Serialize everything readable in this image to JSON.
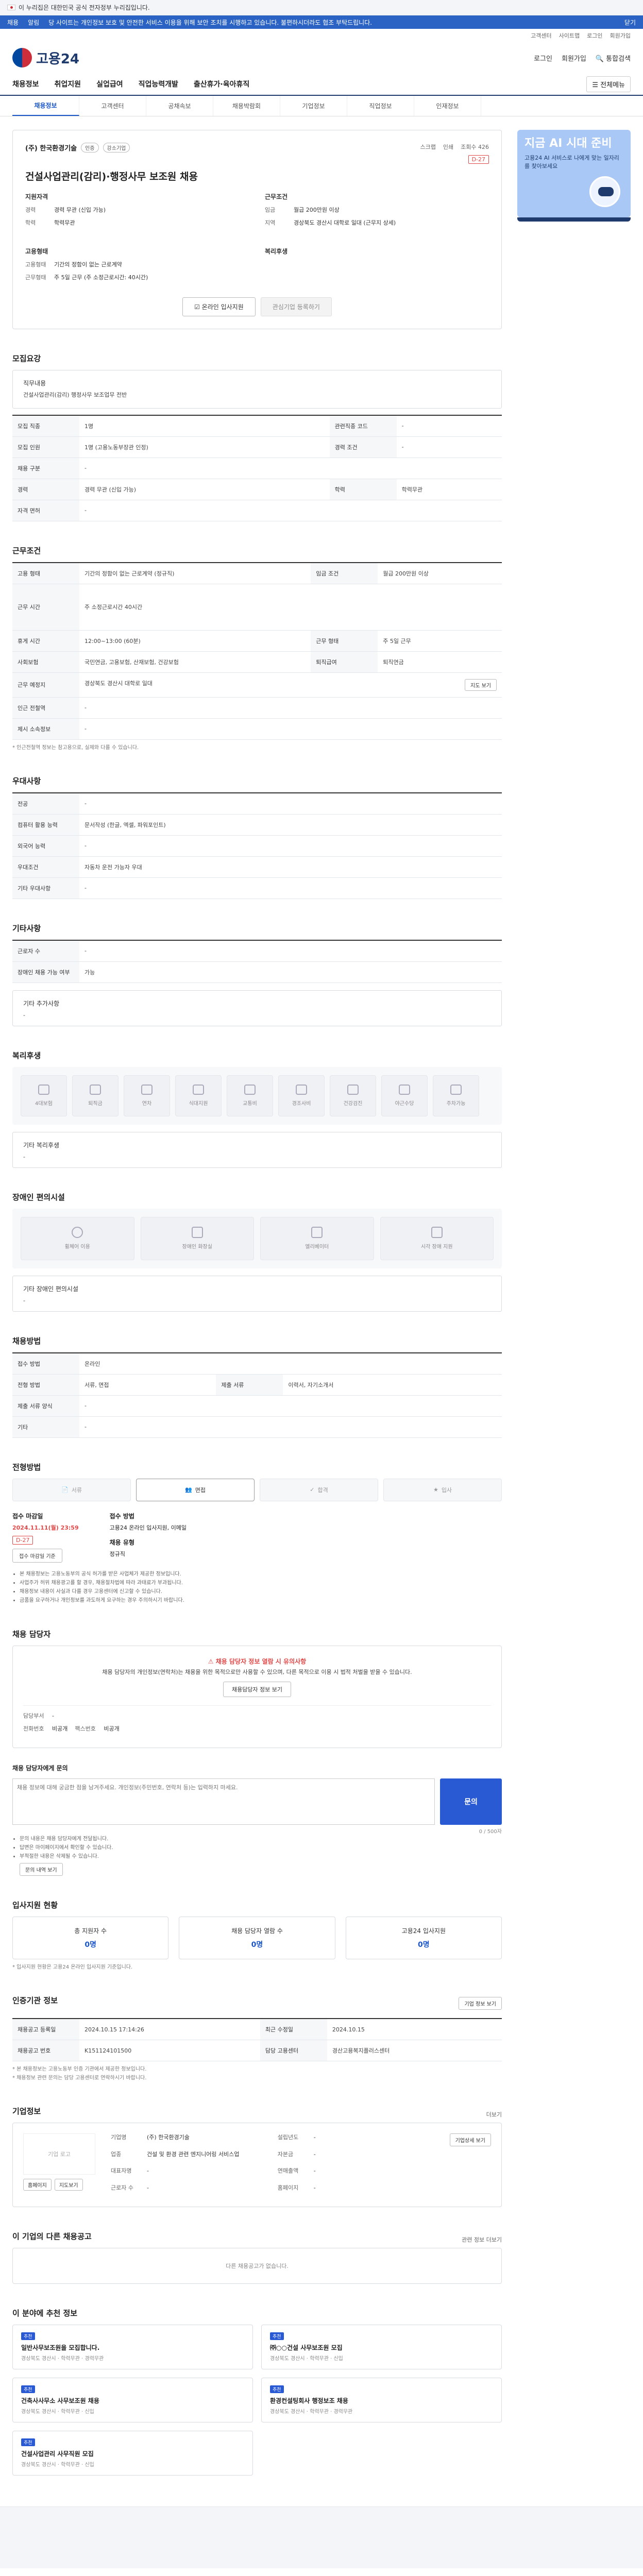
{
  "gov_bar": {
    "text": "이 누리집은 대한민국 공식 전자정부 누리집입니다."
  },
  "notice": {
    "left_items": [
      "채용",
      "알림"
    ],
    "marquee": "당 사이트는 개인정보 보호 및 안전한 서비스 이용을 위해 보안 조치를 시행하고 있습니다. 불편하시더라도 협조 부탁드립니다.",
    "right_items": [
      "닫기"
    ]
  },
  "util": {
    "items": [
      "고객센터",
      "사이트맵",
      "로그인",
      "회원가입"
    ]
  },
  "header": {
    "logo_text": "고용24",
    "right": [
      "로그인",
      "회원가입",
      "통합검색"
    ]
  },
  "gnb": {
    "items": [
      "채용정보",
      "취업지원",
      "실업급여",
      "직업능력개발",
      "출산휴가·육아휴직"
    ],
    "all_menu": "전체메뉴"
  },
  "subtabs": [
    "채용정보",
    "고객센터",
    "공채속보",
    "채용박람회",
    "기업정보",
    "직업정보",
    "인재정보"
  ],
  "banner": {
    "title": "지금 AI 시대 준비",
    "sub": "고용24 AI 서비스로 나에게 맞는 일자리를 찾아보세요"
  },
  "job": {
    "company": "(주) 한국환경기술",
    "badges": [
      "인증",
      "강소기업"
    ],
    "title": "건설사업관리(감리)·행정사무 보조원 채용",
    "actions": [
      "스크랩",
      "인쇄",
      "조회수 426"
    ],
    "dday": "D-27",
    "sec1_title": "지원자격",
    "sec1": [
      {
        "k": "경력",
        "v": "경력 무관 (신입 가능)"
      },
      {
        "k": "학력",
        "v": "학력무관"
      }
    ],
    "sec2_title": "근무조건",
    "sec2": [
      {
        "k": "임금",
        "v": "월급 200만원 이상"
      },
      {
        "k": "지역",
        "v": "경상북도 경산시 대학로 일대 (근무지 상세)"
      }
    ],
    "sec3_title": "고용형태",
    "sec3": [
      {
        "k": "고용형태",
        "v": "기간의 정함이 없는 근로계약"
      },
      {
        "k": "근무형태",
        "v": "주 5일 근무 (주 소정근로시간: 40시간)"
      }
    ],
    "sec4_title": "복리후생",
    "btn_apply": "온라인 입사지원",
    "btn_interest": "관심기업 등록하기"
  },
  "recruit": {
    "title": "모집요강",
    "duty_label": "직무내용",
    "duty": "건설사업관리(감리) 행정사무 보조업무 전반",
    "rows": [
      {
        "k1": "모집 직종",
        "v1": "1명",
        "k2": "관련직종 코드",
        "v2": "-"
      },
      {
        "k1": "모집 인원",
        "v1": "1명 (고용노동부장관 인정)",
        "k2": "경력 조건",
        "v2": "-"
      },
      {
        "k1": "채용 구분",
        "v1": "-",
        "k2": "",
        "v2": ""
      },
      {
        "k1": "경력",
        "v1": "경력 무관 (신입 가능)",
        "k2": "학력",
        "v2": "학력무관"
      },
      {
        "k1": "자격 면허",
        "v1": "-",
        "k2": "",
        "v2": ""
      }
    ]
  },
  "condition": {
    "title": "근무조건",
    "rows": [
      {
        "k1": "고용 형태",
        "v1": "기간의 정함이 없는 근로계약 (정규직)",
        "k2": "임금 조건",
        "v2": "월급 200만원 이상"
      },
      {
        "k1": "근무 시간",
        "v1": "주 소정근로시간 40시간",
        "k2": "",
        "v2": ""
      },
      {
        "k1": "휴게 시간",
        "v1": "12:00~13:00 (60분)",
        "k2": "근무 형태",
        "v2": "주 5일 근무"
      },
      {
        "k1": "사회보험",
        "v1": "국민연금, 고용보험, 산재보험, 건강보험",
        "k2": "퇴직급여",
        "v2": "퇴직연금"
      },
      {
        "k1": "근무 예정지",
        "v1": "경상북도 경산시 대학로 일대",
        "k2": "",
        "v2": ""
      },
      {
        "k1": "인근 전철역",
        "v1": "-",
        "k2": "",
        "v2": ""
      },
      {
        "k1": "제시 소속정보",
        "v1": "-",
        "k2": "",
        "v2": ""
      }
    ],
    "map_button": "지도 보기",
    "note": "* 인근전철역 정보는 참고용으로, 실제와 다를 수 있습니다."
  },
  "preference": {
    "title": "우대사항",
    "rows": [
      {
        "k": "전공",
        "v": "-"
      },
      {
        "k": "컴퓨터 활용 능력",
        "v": "문서작성 (한글, 엑셀, 파워포인트)"
      },
      {
        "k": "외국어 능력",
        "v": "-"
      },
      {
        "k": "우대조건",
        "v": "자동차 운전 가능자 우대"
      },
      {
        "k": "기타 우대사항",
        "v": "-"
      }
    ]
  },
  "etc": {
    "title": "기타사항",
    "rows": [
      {
        "k": "근로자 수",
        "v": "-"
      },
      {
        "k": "장애인 채용 가능 여부",
        "v": "가능"
      }
    ],
    "extra_label": "기타 추가사항",
    "extra_value": "-"
  },
  "welfare": {
    "title": "복리후생",
    "icons": [
      "4대보험",
      "퇴직금",
      "연차",
      "식대지원",
      "교통비",
      "경조사비",
      "건강검진",
      "야근수당",
      "주차가능"
    ],
    "extra_label": "기타 복리후생",
    "extra_value": "-"
  },
  "disabled": {
    "title": "장애인 편의시설",
    "cards": [
      "휠체어 이용",
      "장애인 화장실",
      "엘리베이터",
      "시각 장애 지원"
    ],
    "extra_label": "기타 장애인 편의시설",
    "extra_value": "-"
  },
  "selection": {
    "title": "채용방법",
    "rows": [
      {
        "k1": "접수 방법",
        "v1": "온라인",
        "k2": "",
        "v2": ""
      },
      {
        "k1": "전형 방법",
        "v1": "서류, 면접",
        "k2": "제출 서류",
        "v2": "이력서, 자기소개서"
      },
      {
        "k1": "제출 서류 양식",
        "v1": "-",
        "k2": "",
        "v2": ""
      },
      {
        "k1": "기타",
        "v1": "-",
        "k2": "",
        "v2": ""
      }
    ]
  },
  "process": {
    "title": "전형방법",
    "steps": [
      "서류",
      "면접",
      "합격",
      "입사"
    ],
    "deadline_label": "접수 마감일",
    "deadline": "2024.11.11(월) 23:59",
    "dday": "D-27",
    "btn": "접수 마감일 기준",
    "how_label": "접수 방법",
    "how": "고용24 온라인 입사지원, 이메일",
    "type_label": "채용 유형",
    "type": "정규직",
    "bullets": [
      "본 채용정보는 고용노동부의 공식 허가를 받은 사업체가 제공한 정보입니다.",
      "사업주가 허위 채용광고를 할 경우, 채용절차법에 따라 과태료가 부과됩니다.",
      "채용정보 내용이 사실과 다를 경우 고용센터에 신고할 수 있습니다.",
      "금품을 요구하거나 개인정보를 과도하게 요구하는 경우 주의하시기 바랍니다."
    ]
  },
  "consult": {
    "title": "채용 담당자",
    "warn": "채용 담당자 정보 열람 시 유의사항",
    "body": "채용 담당자의 개인정보(연락처)는 채용을 위한 목적으로만 사용할 수 있으며, 다른 목적으로 이용 시 법적 처벌을 받을 수 있습니다.",
    "btn": "채용담당자 정보 보기",
    "dept_label": "담당부서",
    "dept": "-",
    "phone_label": "전화번호",
    "phone": "비공개",
    "fax_label": "팩스번호",
    "fax": "비공개"
  },
  "inquiry": {
    "title": "채용 담당자에게 문의",
    "placeholder": "채용 정보에 대해 궁금한 점을 남겨주세요. 개인정보(주민번호, 연락처 등)는 입력하지 마세요.",
    "count": "0 / 500자",
    "btn": "문의",
    "bullets": [
      "문의 내용은 채용 담당자에게 전달됩니다.",
      "답변은 마이페이지에서 확인할 수 있습니다.",
      "부적절한 내용은 삭제될 수 있습니다."
    ],
    "link": "문의 내역 보기"
  },
  "stats": {
    "title": "입사지원 현황",
    "cards": [
      {
        "t": "총 지원자 수",
        "n": "0명"
      },
      {
        "t": "채용 담당자 열람 수",
        "n": "0명"
      },
      {
        "t": "고용24 입사지원",
        "n": "0명"
      }
    ],
    "note": "* 입사지원 현황은 고용24 온라인 입사지원 기준입니다."
  },
  "reg": {
    "title": "인증기관 정보",
    "btn": "기업 정보 보기",
    "rows": [
      {
        "k1": "채용공고 등록일",
        "v1": "2024.10.15 17:14:26",
        "k2": "최근 수정일",
        "v2": "2024.10.15"
      },
      {
        "k1": "채용공고 번호",
        "v1": "K151124101500",
        "k2": "담당 고용센터",
        "v2": "경산고용복지플러스센터"
      }
    ],
    "notes": [
      "* 본 채용정보는 고용노동부 인증 기관에서 제공한 정보입니다.",
      "* 채용정보 관련 문의는 담당 고용센터로 연락하시기 바랍니다."
    ]
  },
  "company": {
    "title": "기업정보",
    "more": "더보기",
    "logo_alt": "기업 로고",
    "rows": [
      {
        "k": "기업명",
        "v": "(주) 한국환경기술"
      },
      {
        "k": "업종",
        "v": "건설 및 환경 관련 엔지니어링 서비스업"
      },
      {
        "k": "대표자명",
        "v": "-"
      },
      {
        "k": "근로자 수",
        "v": "-"
      },
      {
        "k": "설립년도",
        "v": "-"
      },
      {
        "k": "자본금",
        "v": "-"
      },
      {
        "k": "연매출액",
        "v": "-"
      },
      {
        "k": "홈페이지",
        "v": "-"
      }
    ],
    "btn_home": "홈페이지",
    "btn_map": "지도보기",
    "btn_detail": "기업상세 보기"
  },
  "similar": {
    "title": "이 기업의 다른 채용공고",
    "more": "관련 정보 더보기",
    "empty": "다른 채용공고가 없습니다."
  },
  "recommend": {
    "title": "이 분야에 추천 정보",
    "items": [
      {
        "tag": "추천",
        "title": "일반사무보조원을 모집합니다.",
        "meta": "경상북도 경산시 · 학력무관 · 경력무관"
      },
      {
        "tag": "추천",
        "title": "㈜○○건설 사무보조원 모집",
        "meta": "경상북도 경산시 · 학력무관 · 신입"
      },
      {
        "tag": "추천",
        "title": "건축사사무소 사무보조원 채용",
        "meta": "경상북도 경산시 · 학력무관 · 신입"
      },
      {
        "tag": "추천",
        "title": "환경컨설팅회사 행정보조 채용",
        "meta": "경상북도 경산시 · 학력무관 · 경력무관"
      },
      {
        "tag": "추천",
        "title": "건설사업관리 사무직원 모집",
        "meta": "경상북도 경산시 · 학력무관 · 신입"
      }
    ]
  }
}
